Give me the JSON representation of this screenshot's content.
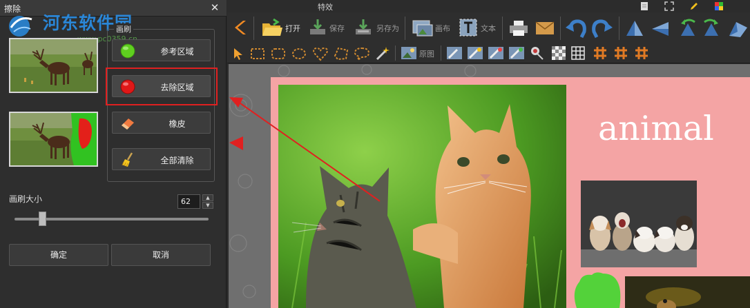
{
  "dialog": {
    "title": "擦除",
    "close_glyph": "✕",
    "watermark_text": "河东软件园",
    "watermark_url": "www.pc0359.cn",
    "brush_group_label": "画刷",
    "buttons": {
      "reference": "参考区域",
      "remove": "去除区域",
      "eraser": "橡皮",
      "clear_all": "全部清除"
    },
    "brush_size_label": "画刷大小",
    "brush_size_value": "62",
    "brush_size_fraction": 0.13,
    "ok": "确定",
    "cancel": "取消"
  },
  "app": {
    "title": "特效",
    "toolbar": {
      "open": "打开",
      "save": "保存",
      "save_as": "另存为",
      "canvas": "画布",
      "text": "文本",
      "original": "原图"
    },
    "canvas": {
      "heading": "animal"
    }
  },
  "colors": {
    "accent_red": "#e02020",
    "page_pink": "#f4a4a4",
    "watermark_blue": "#2a86d6",
    "ref_dot": "#5fcf1f",
    "remove_dot": "#e01818"
  }
}
